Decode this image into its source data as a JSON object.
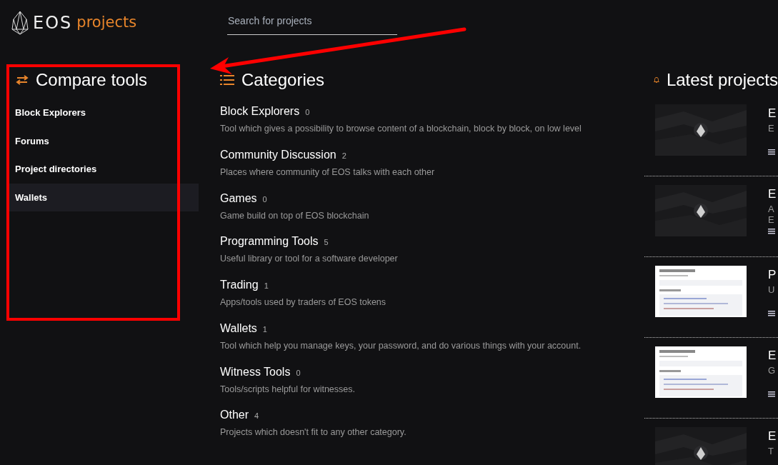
{
  "brand": {
    "word": "EOS",
    "suffix": "projects"
  },
  "search": {
    "placeholder": "Search for projects"
  },
  "sidebar": {
    "title": "Compare tools",
    "items": [
      {
        "label": "Block Explorers",
        "selected": false
      },
      {
        "label": "Forums",
        "selected": false
      },
      {
        "label": "Project directories",
        "selected": false
      },
      {
        "label": "Wallets",
        "selected": true
      }
    ]
  },
  "categories": {
    "title": "Categories",
    "items": [
      {
        "name": "Block Explorers",
        "count": "0",
        "description": "Tool which gives a possibility to browse content of a blockchain, block by block, on low level"
      },
      {
        "name": "Community Discussion",
        "count": "2",
        "description": "Places where community of EOS talks with each other"
      },
      {
        "name": "Games",
        "count": "0",
        "description": "Game build on top of EOS blockchain"
      },
      {
        "name": "Programming Tools",
        "count": "5",
        "description": "Useful library or tool for a software developer"
      },
      {
        "name": "Trading",
        "count": "1",
        "description": "Apps/tools used by traders of EOS tokens"
      },
      {
        "name": "Wallets",
        "count": "1",
        "description": "Tool which help you manage keys, your password, and do various things with your account."
      },
      {
        "name": "Witness Tools",
        "count": "0",
        "description": "Tools/scripts helpful for witnesses."
      },
      {
        "name": "Other",
        "count": "4",
        "description": "Projects which doesn't fit to any other category."
      }
    ]
  },
  "latest": {
    "title": "Latest projects",
    "items": [
      {
        "title": "E",
        "description": [
          "E"
        ]
      },
      {
        "title": "E",
        "description": [
          "A",
          "E"
        ]
      },
      {
        "title": "P",
        "description": [
          "U"
        ]
      },
      {
        "title": "E",
        "description": [
          "G"
        ]
      },
      {
        "title": "E",
        "description": [
          "T"
        ]
      }
    ]
  }
}
